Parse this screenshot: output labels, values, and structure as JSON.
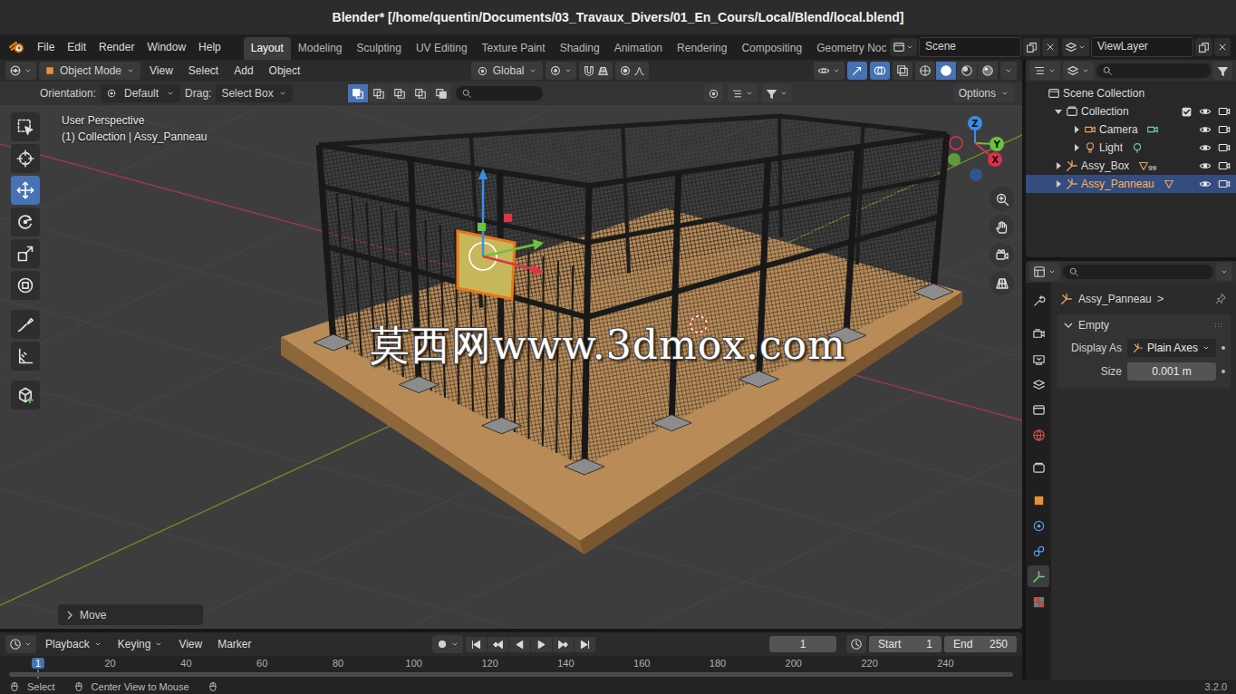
{
  "window": {
    "title": "Blender* [/home/quentin/Documents/03_Travaux_Divers/01_En_Cours/Local/Blend/local.blend]"
  },
  "menu": [
    "File",
    "Edit",
    "Render",
    "Window",
    "Help"
  ],
  "workspaces": [
    {
      "label": "Layout",
      "selected": true
    },
    {
      "label": "Modeling",
      "selected": false
    },
    {
      "label": "Sculpting",
      "selected": false
    },
    {
      "label": "UV Editing",
      "selected": false
    },
    {
      "label": "Texture Paint",
      "selected": false
    },
    {
      "label": "Shading",
      "selected": false
    },
    {
      "label": "Animation",
      "selected": false
    },
    {
      "label": "Rendering",
      "selected": false
    },
    {
      "label": "Compositing",
      "selected": false
    },
    {
      "label": "Geometry Noc",
      "selected": false
    }
  ],
  "scene": {
    "label": "Scene"
  },
  "view_layer": {
    "label": "ViewLayer"
  },
  "viewport": {
    "header": {
      "mode": "Object Mode",
      "menus": [
        "View",
        "Select",
        "Add",
        "Object"
      ],
      "transform": "Global"
    },
    "shading": [
      {
        "kind": "wire",
        "selected": false
      },
      {
        "kind": "solid",
        "selected": true
      },
      {
        "kind": "material",
        "selected": false
      },
      {
        "kind": "rendered",
        "selected": false
      }
    ],
    "tool_settings": {
      "orientation_label": "Orientation:",
      "orientation": "Default",
      "drag_label": "Drag:",
      "drag": "Select Box",
      "options": "Options"
    },
    "select_modes": [
      {
        "kind": "set",
        "selected": true
      },
      {
        "kind": "extend",
        "selected": false
      },
      {
        "kind": "subtract",
        "selected": false
      },
      {
        "kind": "invert",
        "selected": false
      },
      {
        "kind": "intersect",
        "selected": false
      }
    ],
    "overlay_text": [
      "User Perspective",
      "(1) Collection | Assy_Panneau"
    ],
    "tools": [
      {
        "kind": "select",
        "selected": false
      },
      {
        "kind": "cursor",
        "selected": false
      },
      {
        "kind": "move",
        "selected": true
      },
      {
        "kind": "rotate",
        "selected": false
      },
      {
        "kind": "scale",
        "selected": false
      },
      {
        "kind": "transform",
        "selected": false
      },
      {
        "kind": "annotate",
        "selected": false
      },
      {
        "kind": "measure",
        "selected": false
      },
      {
        "kind": "add-cube",
        "selected": false
      }
    ],
    "gizmo": {
      "x": "X",
      "y": "Y",
      "z": "Z"
    },
    "last_operator": {
      "label": "Move",
      "expanded": false
    },
    "watermark": "莫西网www.3dmox.com"
  },
  "outliner": {
    "rows": [
      {
        "label": "Scene Collection",
        "depth": 0,
        "kind": "scene",
        "selected": false
      },
      {
        "label": "Collection",
        "depth": 1,
        "kind": "collection",
        "expanded": true,
        "checkbox": true,
        "visible": true,
        "renderable": true,
        "selected": false
      },
      {
        "label": "Camera",
        "depth": 2,
        "kind": "camera",
        "child_kind": "camera-data",
        "expanded": false,
        "visible": true,
        "renderable": true,
        "selected": false
      },
      {
        "label": "Light",
        "depth": 2,
        "kind": "light",
        "child_kind": "light-data",
        "expanded": false,
        "visible": true,
        "renderable": true,
        "selected": false
      },
      {
        "label": "Assy_Box",
        "depth": 1,
        "kind": "empty",
        "child_kind": "children",
        "badge": "99",
        "expanded": false,
        "visible": true,
        "renderable": true,
        "selected": false
      },
      {
        "label": "Assy_Panneau",
        "depth": 1,
        "kind": "empty",
        "child_kind": "children",
        "expanded": false,
        "visible": true,
        "renderable": true,
        "selected": true
      }
    ]
  },
  "properties": {
    "tabs": [
      {
        "kind": "tool",
        "selected": false
      },
      {
        "kind": "render",
        "selected": false
      },
      {
        "kind": "output",
        "selected": false
      },
      {
        "kind": "view-layer",
        "selected": false
      },
      {
        "kind": "scene",
        "selected": false
      },
      {
        "kind": "world",
        "selected": false
      },
      {
        "kind": "collection",
        "selected": false
      },
      {
        "kind": "object",
        "selected": false
      },
      {
        "kind": "physics",
        "selected": false
      },
      {
        "kind": "constraints",
        "selected": false
      },
      {
        "kind": "data",
        "selected": true
      },
      {
        "kind": "texture",
        "selected": false
      }
    ],
    "object": "Assy_Panneau",
    "separator": ">",
    "panel": {
      "title": "Empty",
      "expanded": true,
      "fields": [
        {
          "label": "Display As",
          "value": "Plain Axes",
          "kind": "dropdown"
        },
        {
          "label": "Size",
          "value": "0.001 m",
          "kind": "number"
        }
      ]
    }
  },
  "timeline": {
    "menus": [
      {
        "label": "Playback",
        "dropdown": true
      },
      {
        "label": "Keying",
        "dropdown": true
      },
      {
        "label": "View",
        "dropdown": false
      },
      {
        "label": "Marker",
        "dropdown": false
      }
    ],
    "current_frame": "1",
    "start_label": "Start",
    "start": "1",
    "end_label": "End",
    "end": "250",
    "ticks": [
      "1",
      "20",
      "40",
      "60",
      "80",
      "100",
      "120",
      "140",
      "160",
      "180",
      "200",
      "220",
      "240"
    ]
  },
  "status_bar": {
    "items": [
      "Select",
      "Center View to Mouse"
    ],
    "version": "3.2.0"
  }
}
